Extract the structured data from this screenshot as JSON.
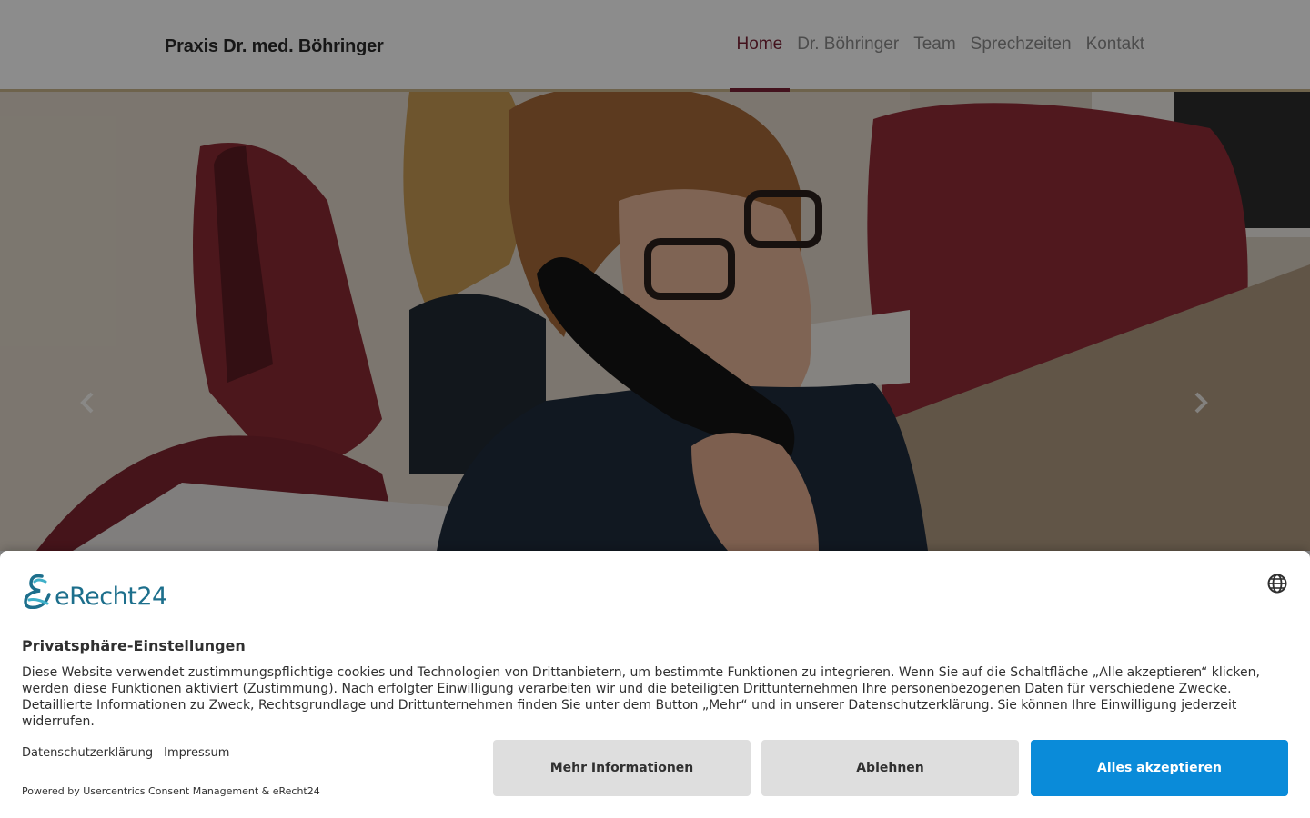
{
  "header": {
    "brand": "Praxis Dr. med. Böhringer",
    "nav": [
      {
        "label": "Home",
        "active": true
      },
      {
        "label": "Dr. Böhringer",
        "active": false
      },
      {
        "label": "Team",
        "active": false
      },
      {
        "label": "Sprechzeiten",
        "active": false
      },
      {
        "label": "Kontakt",
        "active": false
      }
    ]
  },
  "hero": {
    "prev_icon": "chevron-left-icon",
    "next_icon": "chevron-right-icon"
  },
  "consent": {
    "logo_text": "eRecht24",
    "language_icon": "globe-icon",
    "title": "Privatsphäre-Einstellungen",
    "text": "Diese Website verwendet zustimmungspflichtige cookies und Technologien von Drittanbietern, um bestimmte Funktionen zu integrieren. Wenn Sie auf die Schaltfläche „Alle akzeptieren“ klicken, werden diese Funktionen aktiviert (Zustimmung). Nach erfolgter Einwilligung verarbeiten wir und die beteiligten Drittunternehmen Ihre personenbezogenen Daten für verschiedene Zwecke. Detaillierte Informationen zu Zweck, Rechtsgrundlage und Drittunternehmen finden Sie unter dem Button „Mehr“ und in unserer Datenschutzerklärung. Sie können Ihre Einwilligung jederzeit widerrufen.",
    "links": {
      "privacy": "Datenschutzerklärung",
      "imprint": "Impressum"
    },
    "powered_by": "Powered by Usercentrics Consent Management & eRecht24",
    "buttons": {
      "more": "Mehr Informationen",
      "deny": "Ablehnen",
      "accept": "Alles akzeptieren"
    },
    "colors": {
      "accept_bg": "#0a8bd9",
      "secondary_bg": "#dedede",
      "logo": "#1d6f8c"
    }
  },
  "colors": {
    "nav_active": "#7a2236",
    "header_border": "#c8b48a"
  }
}
